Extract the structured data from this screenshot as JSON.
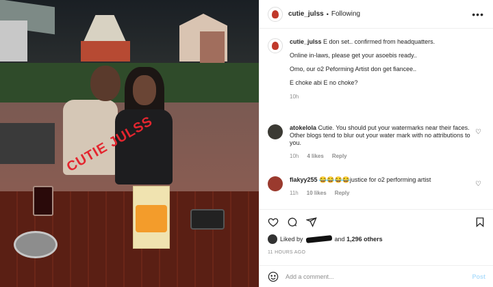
{
  "post": {
    "username": "cutie_julss",
    "follow_status": "Following",
    "more_label": "•••",
    "photo_watermark": "CUTIE JULSS"
  },
  "caption": {
    "username": "cutie_julss",
    "lines": [
      "E don set.. confirmed from headquatters.",
      "Online in-laws, please get your asoebis ready..",
      "Omo, our o2 Peforming Artist don get fiancee..",
      "E choke abi E no choke?"
    ],
    "time": "10h"
  },
  "comments": [
    {
      "username": "atokelola",
      "text": "Cutie. You should put your watermarks near their faces. Other blogs tend to blur out your water mark with no attributions to you.",
      "time": "10h",
      "likes": "4 likes",
      "reply": "Reply"
    },
    {
      "username": "flakyy255",
      "text": "😂😂😂😂justice for o2 performing artist",
      "time": "11h",
      "likes": "10 likes",
      "reply": "Reply"
    }
  ],
  "likes_line": {
    "prefix": "Liked by",
    "suffix": "and",
    "count": "1,296 others"
  },
  "time_ago": "11 HOURS AGO",
  "add_comment": {
    "placeholder": "Add a comment...",
    "post_label": "Post"
  },
  "colors": {
    "text": "#262626",
    "muted": "#8e8e8e",
    "post_disabled": "#b2dffc",
    "watermark": "#e3262f"
  }
}
